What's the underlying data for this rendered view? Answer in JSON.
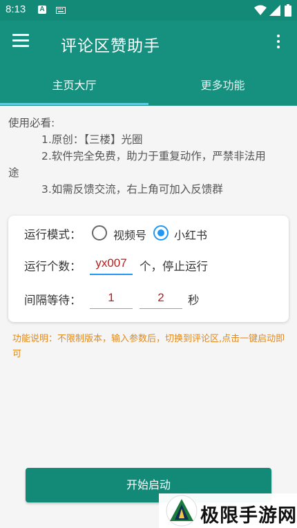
{
  "status_bar": {
    "time": "8:13",
    "notification_icon": "A",
    "icons": [
      "app-notification-icon",
      "keyboard-icon",
      "wifi-icon",
      "signal-icon",
      "battery-icon"
    ]
  },
  "app_bar": {
    "title": "评论区赞助手",
    "menu_icon": "hamburger-menu-icon",
    "overflow_icon": "more-vert-icon"
  },
  "tabs": [
    {
      "label": "主页大厅",
      "active": true
    },
    {
      "label": "更多功能",
      "active": false
    }
  ],
  "notice": {
    "heading": "使用必看:",
    "line1": "1.原创：【三楼】光圈",
    "line2a": "2.软件完全免费，助力于重复动作，严禁非法用",
    "line2b": "途",
    "line3": "3.如需反馈交流，右上角可加入反馈群"
  },
  "settings": {
    "mode_label": "运行模式：",
    "mode_options": [
      {
        "label": "视频号",
        "selected": false
      },
      {
        "label": "小红书",
        "selected": true
      }
    ],
    "count_label": "运行个数：",
    "count_value": "yx007",
    "count_suffix": "个，停止运行",
    "interval_label": "间隔等待：",
    "interval_min": "1",
    "interval_max": "2",
    "interval_unit": "秒"
  },
  "description": "功能说明：不限制版本，输入参数后，切换到评论区,点击一键启动即可",
  "start_button": "开始启动",
  "watermark": {
    "text": "极限手游网"
  },
  "colors": {
    "primary": "#16917f",
    "primary_dark": "#138a78",
    "accent": "#2196f3",
    "tab_indicator": "#5fc8f7",
    "description_text": "#e08a1e",
    "field_text": "#b71c1c"
  }
}
